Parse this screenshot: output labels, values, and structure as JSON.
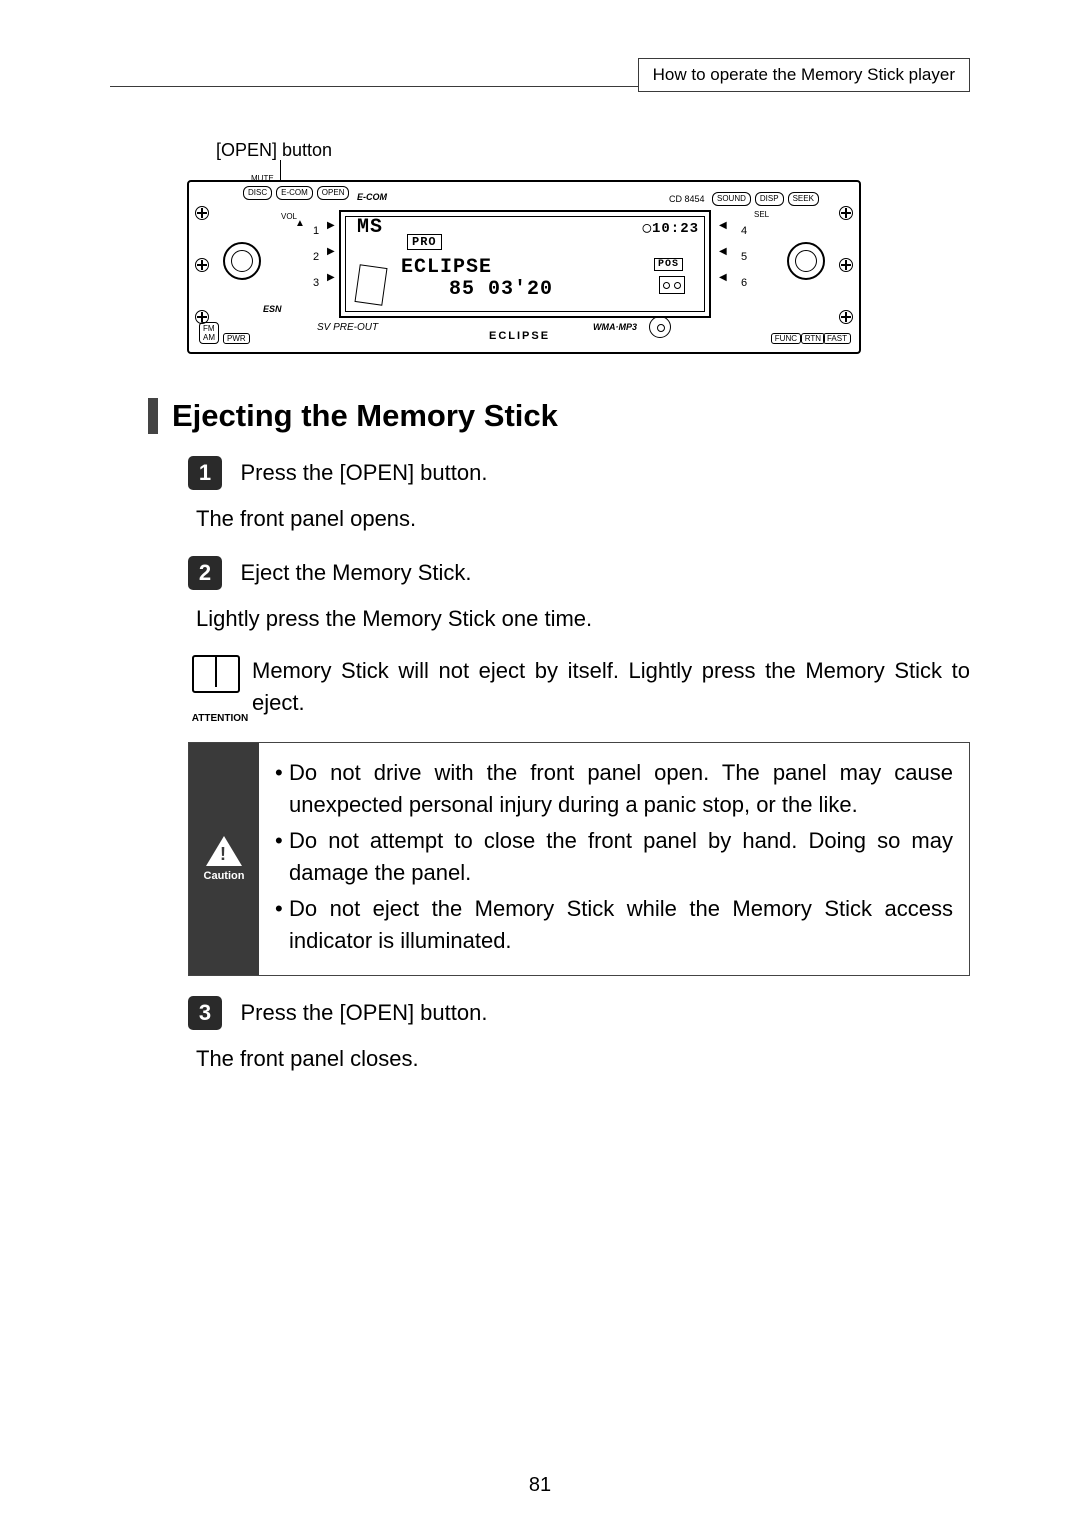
{
  "header": {
    "breadcrumb": "How to operate the Memory Stick player"
  },
  "figure": {
    "callout": "[OPEN] button",
    "top_buttons": [
      "DISC",
      "E-COM",
      "OPEN"
    ],
    "mute": "MUTE",
    "ecom_logo": "E-COM",
    "model": "CD 8454",
    "badges": [
      "SOUND",
      "DISP",
      "SEEK"
    ],
    "vol": "VOL",
    "sel": "SEL",
    "eject": "▲",
    "left_nums": [
      "1",
      "2",
      "3"
    ],
    "right_nums": [
      "4",
      "5",
      "6"
    ],
    "left_tris": [
      "▶",
      "▶",
      "▶"
    ],
    "right_tris": [
      "◀",
      "◀",
      "◀"
    ],
    "esn": "ESN",
    "sv": "SV PRE-OUT",
    "brand": "ECLIPSE",
    "wma": "WMA·MP3",
    "fmam": "FM\nAM",
    "pwr": "PWR",
    "func": "FUNC",
    "rtn": "RTN",
    "fast": "FAST",
    "lcd": {
      "line1": "MS",
      "pro": "PRO",
      "clock": "◯10:23",
      "line2": "ECLIPSE",
      "pos": "POS",
      "line3": "85  03'20"
    }
  },
  "section": {
    "title": "Ejecting the Memory Stick"
  },
  "steps": [
    {
      "num": "1",
      "title": "Press the [OPEN] button.",
      "body": "The front panel opens."
    },
    {
      "num": "2",
      "title": "Eject the Memory Stick.",
      "body": "Lightly press the Memory Stick one time."
    },
    {
      "num": "3",
      "title": "Press the [OPEN] button.",
      "body": "The front panel closes."
    }
  ],
  "attention": {
    "label": "ATTENTION",
    "text": "Memory Stick will not eject by itself. Lightly press the Memory Stick to eject."
  },
  "caution": {
    "label": "Caution",
    "bullets": [
      "Do not drive with the front panel open. The panel may cause unexpected personal injury during a panic stop, or the like.",
      "Do not attempt to close the front panel by hand. Doing so may damage the panel.",
      "Do not eject the Memory Stick while the Memory Stick access indicator is illuminated."
    ]
  },
  "page_number": "81"
}
